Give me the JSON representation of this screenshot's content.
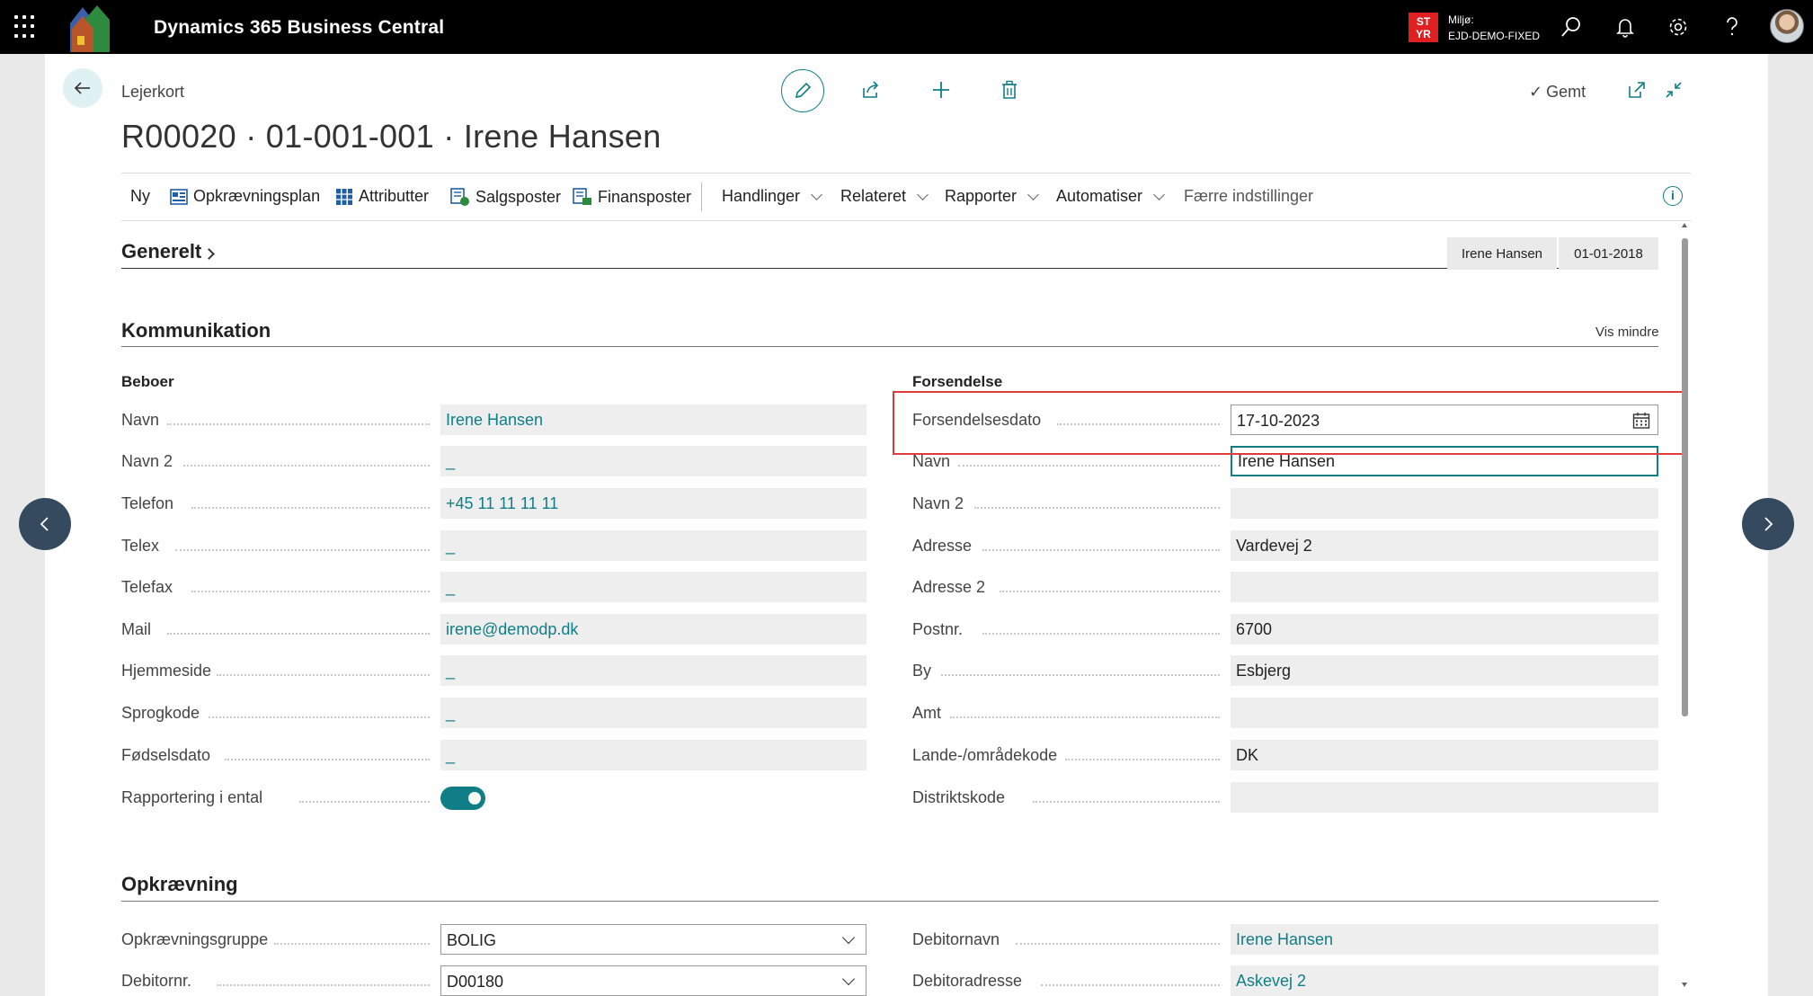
{
  "app": {
    "title": "Dynamics 365 Business Central",
    "env_badge_line1": "ST",
    "env_badge_line2": "YR",
    "env_label": "Miljø:",
    "env_name": "EJD-DEMO-FIXED"
  },
  "page": {
    "breadcrumb": "Lejerkort",
    "title": "R00020 · 01-001-001 · Irene Hansen",
    "saved_label": "Gemt"
  },
  "actionbar": {
    "new": "Ny",
    "plan": "Opkrævningsplan",
    "attributes": "Attributter",
    "sales": "Salgsposter",
    "finance": "Finansposter",
    "actions": "Handlinger",
    "related": "Relateret",
    "reports": "Rapporter",
    "automate": "Automatiser",
    "fewer": "Færre indstillinger"
  },
  "general": {
    "title": "Generelt",
    "chip_name": "Irene Hansen",
    "chip_date": "01-01-2018"
  },
  "communication": {
    "title": "Kommunikation",
    "show_less": "Vis mindre",
    "resident": {
      "title": "Beboer",
      "fields": [
        {
          "label": "Navn",
          "value": "Irene Hansen"
        },
        {
          "label": "Navn 2",
          "value": "_"
        },
        {
          "label": "Telefon",
          "value": "+45 11 11 11 11"
        },
        {
          "label": "Telex",
          "value": "_"
        },
        {
          "label": "Telefax",
          "value": "_"
        },
        {
          "label": "Mail",
          "value": "irene@demodp.dk"
        },
        {
          "label": "Hjemmeside",
          "value": "_"
        },
        {
          "label": "Sprogkode",
          "value": "_"
        },
        {
          "label": "Fødselsdato",
          "value": "_"
        },
        {
          "label": "Rapportering i ental",
          "value": "on"
        }
      ]
    },
    "shipping": {
      "title": "Forsendelse",
      "fields": [
        {
          "label": "Forsendelsesdato",
          "value": "17-10-2023"
        },
        {
          "label": "Navn",
          "value": "Irene Hansen"
        },
        {
          "label": "Navn 2",
          "value": ""
        },
        {
          "label": "Adresse",
          "value": "Vardevej 2"
        },
        {
          "label": "Adresse 2",
          "value": ""
        },
        {
          "label": "Postnr.",
          "value": "6700"
        },
        {
          "label": "By",
          "value": "Esbjerg"
        },
        {
          "label": "Amt",
          "value": ""
        },
        {
          "label": "Lande-/områdekode",
          "value": "DK"
        },
        {
          "label": "Distriktskode",
          "value": ""
        }
      ]
    }
  },
  "billing": {
    "title": "Opkrævning",
    "fields_left": [
      {
        "label": "Opkrævningsgruppe",
        "value": "BOLIG"
      },
      {
        "label": "Debitornr.",
        "value": "D00180"
      }
    ],
    "fields_right": [
      {
        "label": "Debitornavn",
        "value": "Irene Hansen"
      },
      {
        "label": "Debitoradresse",
        "value": "Askevej 2"
      }
    ]
  },
  "colors": {
    "accent": "#0f7e86",
    "topbar": "#000000",
    "highlight": "#e03a3a",
    "env_badge": "#e02020"
  }
}
